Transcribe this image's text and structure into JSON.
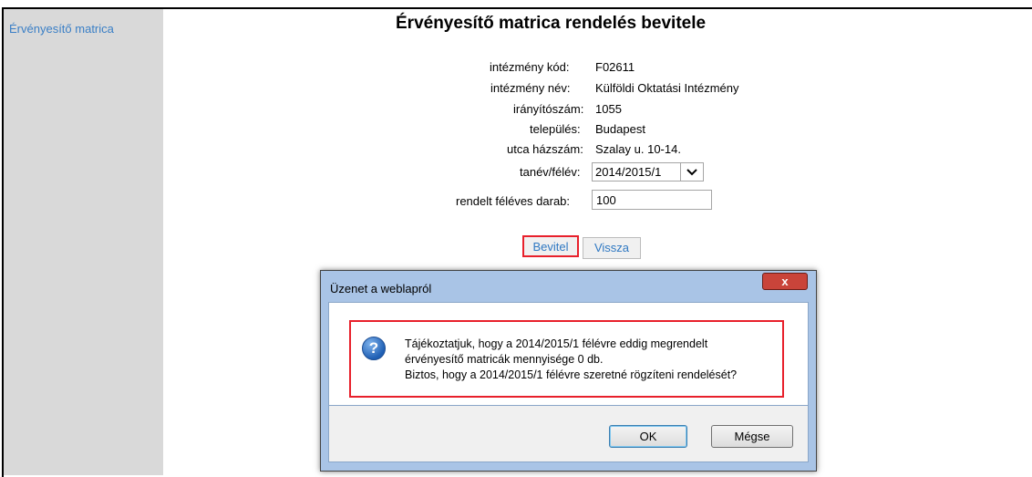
{
  "sidebar": {
    "link_label": "Érvényesítő matrica"
  },
  "page": {
    "title": "Érvényesítő matrica rendelés bevitele"
  },
  "info": [
    {
      "label": "intézmény kód:",
      "value": "F02611"
    },
    {
      "label": "intézmény név:",
      "value": "Külföldi Oktatási Intézmény"
    },
    {
      "label": "irányítószám:",
      "value": "1055"
    },
    {
      "label": "település:",
      "value": "Budapest"
    },
    {
      "label": "utca házszám:",
      "value": "Szalay u. 10-14."
    }
  ],
  "form": {
    "semester_label": "tanév/félév:",
    "semester_value": "2014/2015/1",
    "quantity_label": "rendelt féléves darab:",
    "quantity_value": "100",
    "submit_label": "Bevitel",
    "back_label": "Vissza"
  },
  "dialog": {
    "title": "Üzenet a weblapról",
    "close_label": "x",
    "icon": "question-icon",
    "message_lines": [
      "Tájékoztatjuk, hogy a 2014/2015/1 félévre eddig megrendelt",
      "érvényesítő matricák mennyisége 0 db.",
      "Biztos, hogy a 2014/2015/1 félévre szeretné rögzíteni rendelését?"
    ],
    "ok_label": "OK",
    "cancel_label": "Mégse"
  },
  "colors": {
    "highlight": "#e8202b",
    "link": "#3a7fc6",
    "sidebar_bg": "#d9d9d9",
    "dialog_frame": "#a9c4e6"
  }
}
